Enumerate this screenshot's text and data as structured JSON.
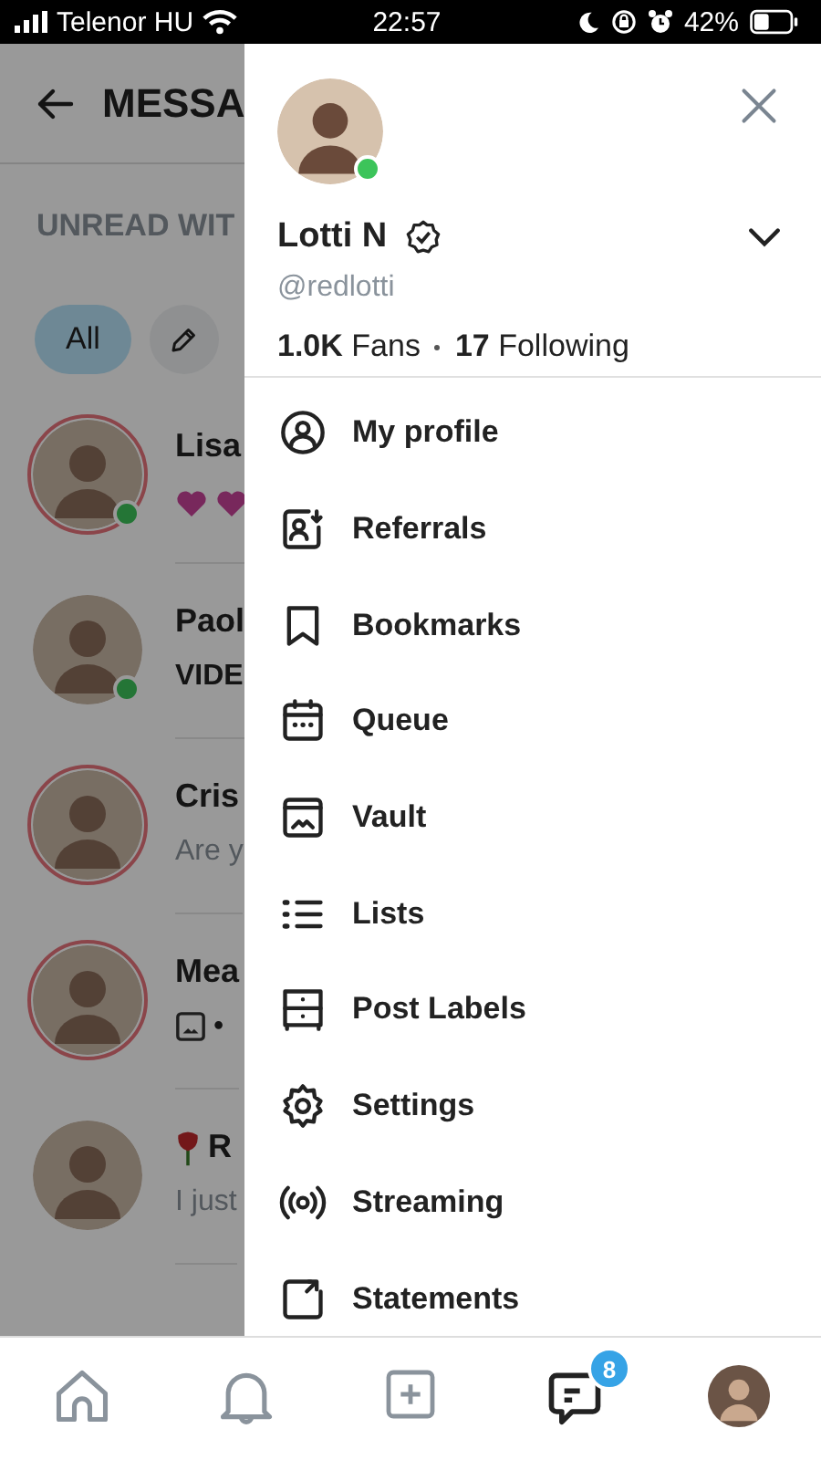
{
  "status_bar": {
    "carrier": "Telenor HU",
    "time": "22:57",
    "battery": "42%"
  },
  "background": {
    "title": "MESSA",
    "section": "UNREAD WIT",
    "filters": [
      {
        "label": "All",
        "selected": true
      }
    ],
    "chats": [
      {
        "name": "Lisa",
        "preview_icons": [
          {
            "kind": "hearts"
          }
        ],
        "online": true,
        "ring": true
      },
      {
        "name": "Paol",
        "preview": "VIDE",
        "kind": "bold",
        "online": true,
        "ring": false
      },
      {
        "name": "Cris",
        "preview": "Are y",
        "kind": "muted",
        "online": false,
        "ring": true
      },
      {
        "name": "Mea",
        "preview": "•",
        "kind": "plain",
        "preview_icons": [
          {
            "kind": "image"
          }
        ],
        "online": false,
        "ring": true
      },
      {
        "name": "R",
        "name_icons": [
          {
            "kind": "rose"
          }
        ],
        "preview": "I just",
        "kind": "muted",
        "online": false,
        "ring": false
      }
    ]
  },
  "drawer": {
    "profile": {
      "name": "Lotti N",
      "verified": true,
      "handle": "@redlotti",
      "online": true,
      "fans": "1.0K",
      "fans_label": "Fans",
      "following": "17",
      "following_label": "Following"
    },
    "menu": [
      {
        "label": "My profile",
        "kind": "profile"
      },
      {
        "label": "Referrals",
        "kind": "referrals"
      },
      {
        "label": "Bookmarks",
        "kind": "bookmark"
      },
      {
        "label": "Queue",
        "kind": "queue"
      },
      {
        "label": "Vault",
        "kind": "vault"
      },
      {
        "label": "Lists",
        "kind": "lists"
      },
      {
        "label": "Post Labels",
        "kind": "labels"
      },
      {
        "label": "Settings",
        "kind": "settings"
      },
      {
        "label": "Streaming",
        "kind": "streaming"
      },
      {
        "label": "Statements",
        "kind": "statements"
      }
    ]
  },
  "bottom_nav": [
    {
      "kind": "home"
    },
    {
      "kind": "bell"
    },
    {
      "kind": "add"
    },
    {
      "kind": "messages",
      "badge": "8"
    },
    {
      "kind": "avatar"
    }
  ]
}
